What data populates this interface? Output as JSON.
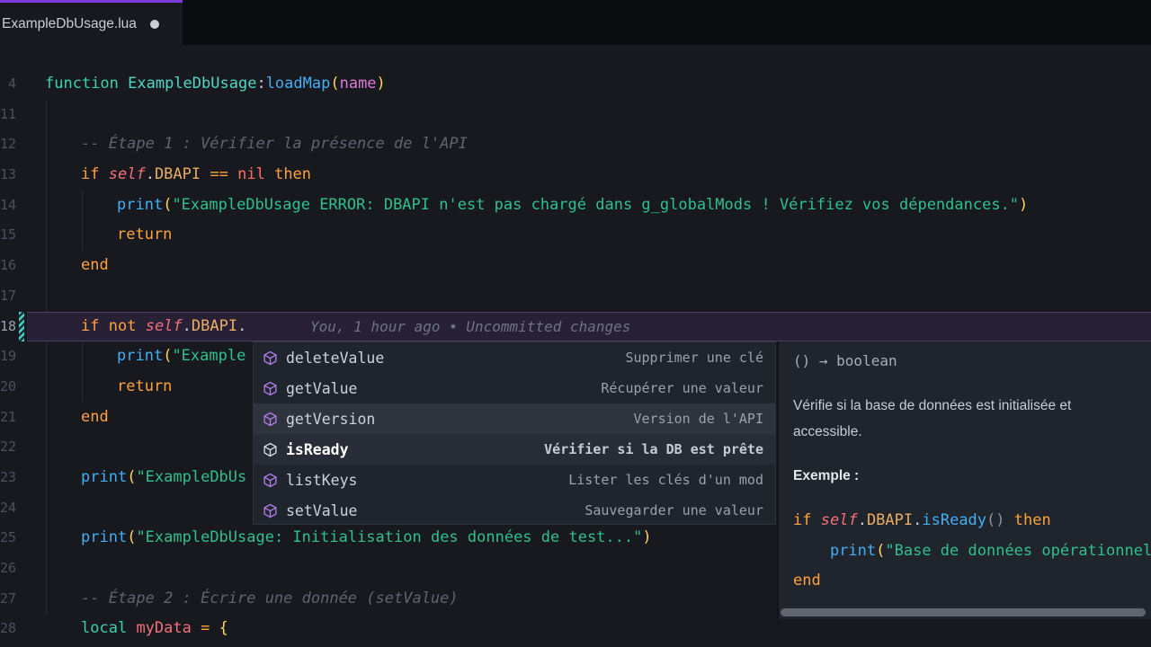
{
  "tab": {
    "title": "ExampleDbUsage.lua",
    "modified": true
  },
  "colors": {
    "editor_bg": "#17191e",
    "tabbar_bg": "#0b0c10",
    "tab_accent": "#7e3bd8",
    "popup_bg": "#20242c",
    "current_line_bg": "#282136",
    "git_modified": "#40d4c6",
    "keyword": "#ffa23e",
    "string": "#2fc08c",
    "function": "#43aef3",
    "property": "#e8ae62",
    "self": "#f2707c",
    "comment": "#5d6470",
    "method_icon": "#b07ce8"
  },
  "editor": {
    "blame": "You, 1 hour ago • Uncommitted changes",
    "lines": [
      {
        "num": "4",
        "indent": 0,
        "tokens": [
          [
            "decl",
            "function"
          ],
          [
            "plain",
            " "
          ],
          [
            "class",
            "ExampleDbUsage"
          ],
          [
            "punc",
            ":"
          ],
          [
            "fn",
            "loadMap"
          ],
          [
            "paren",
            "("
          ],
          [
            "param",
            "name"
          ],
          [
            "paren",
            ")"
          ]
        ]
      },
      {
        "num": "11",
        "indent": 0,
        "tokens": []
      },
      {
        "num": "12",
        "indent": 1,
        "tokens": [
          [
            "cmt",
            "-- Étape 1 : Vérifier la présence de l'API"
          ]
        ]
      },
      {
        "num": "13",
        "indent": 1,
        "tokens": [
          [
            "kw",
            "if"
          ],
          [
            "plain",
            " "
          ],
          [
            "self",
            "self"
          ],
          [
            "punc",
            "."
          ],
          [
            "prop",
            "DBAPI"
          ],
          [
            "plain",
            " "
          ],
          [
            "op",
            "=="
          ],
          [
            "plain",
            " "
          ],
          [
            "nil",
            "nil"
          ],
          [
            "plain",
            " "
          ],
          [
            "kw",
            "then"
          ]
        ]
      },
      {
        "num": "14",
        "indent": 2,
        "tokens": [
          [
            "fn",
            "print"
          ],
          [
            "paren",
            "("
          ],
          [
            "str",
            "\"ExampleDbUsage ERROR: DBAPI n'est pas chargé dans g_globalMods ! Vérifiez vos dépendances.\""
          ],
          [
            "paren",
            ")"
          ]
        ]
      },
      {
        "num": "15",
        "indent": 2,
        "tokens": [
          [
            "kw",
            "return"
          ]
        ]
      },
      {
        "num": "16",
        "indent": 1,
        "tokens": [
          [
            "kw",
            "end"
          ]
        ]
      },
      {
        "num": "17",
        "indent": 0,
        "tokens": []
      },
      {
        "num": "18",
        "indent": 1,
        "current": true,
        "tokens": [
          [
            "kw",
            "if"
          ],
          [
            "plain",
            " "
          ],
          [
            "kw",
            "not"
          ],
          [
            "plain",
            " "
          ],
          [
            "self",
            "self"
          ],
          [
            "punc",
            "."
          ],
          [
            "prop",
            "DBAPI"
          ],
          [
            "punc",
            "."
          ]
        ]
      },
      {
        "num": "19",
        "indent": 2,
        "tokens": [
          [
            "fn",
            "print"
          ],
          [
            "paren",
            "("
          ],
          [
            "str",
            "\"Example"
          ]
        ]
      },
      {
        "num": "20",
        "indent": 2,
        "tokens": [
          [
            "kw",
            "return"
          ]
        ]
      },
      {
        "num": "21",
        "indent": 1,
        "tokens": [
          [
            "kw",
            "end"
          ]
        ]
      },
      {
        "num": "22",
        "indent": 0,
        "tokens": []
      },
      {
        "num": "23",
        "indent": 1,
        "tokens": [
          [
            "fn",
            "print"
          ],
          [
            "paren",
            "("
          ],
          [
            "str",
            "\"ExampleDbUs"
          ]
        ]
      },
      {
        "num": "24",
        "indent": 0,
        "tokens": []
      },
      {
        "num": "25",
        "indent": 1,
        "tokens": [
          [
            "fn",
            "print"
          ],
          [
            "paren",
            "("
          ],
          [
            "str",
            "\"ExampleDbUsage: Initialisation des données de test...\""
          ],
          [
            "paren",
            ")"
          ]
        ]
      },
      {
        "num": "26",
        "indent": 0,
        "tokens": []
      },
      {
        "num": "27",
        "indent": 1,
        "tokens": [
          [
            "cmt",
            "-- Étape 2 : Écrire une donnée (setValue)"
          ]
        ]
      },
      {
        "num": "28",
        "indent": 1,
        "tokens": [
          [
            "decl",
            "local"
          ],
          [
            "plain",
            " "
          ],
          [
            "var",
            "myData"
          ],
          [
            "plain",
            " "
          ],
          [
            "op",
            "="
          ],
          [
            "plain",
            " "
          ],
          [
            "paren",
            "{"
          ]
        ]
      }
    ]
  },
  "suggest": {
    "items": [
      {
        "label": "deleteValue",
        "detail": "Supprimer une clé",
        "state": ""
      },
      {
        "label": "getValue",
        "detail": "Récupérer une valeur",
        "state": ""
      },
      {
        "label": "getVersion",
        "detail": "Version de l'API",
        "state": "hover"
      },
      {
        "label": "isReady",
        "detail": "Vérifier si la DB est prête",
        "state": "selected"
      },
      {
        "label": "listKeys",
        "detail": "Lister les clés d'un mod",
        "state": ""
      },
      {
        "label": "setValue",
        "detail": "Sauvegarder une valeur",
        "state": ""
      }
    ]
  },
  "docs": {
    "signature": "() → boolean",
    "description": "Vérifie si la base de données est initialisée et accessible.",
    "example_label": "Exemple :",
    "code": [
      [
        [
          "kw",
          "if"
        ],
        [
          "plain",
          " "
        ],
        [
          "self",
          "self"
        ],
        [
          "punc",
          "."
        ],
        [
          "prop",
          "DBAPI"
        ],
        [
          "punc",
          "."
        ],
        [
          "fn",
          "isReady"
        ],
        [
          "punc2",
          "()"
        ],
        [
          "plain",
          " "
        ],
        [
          "kw",
          "then"
        ]
      ],
      [
        [
          "plain",
          "    "
        ],
        [
          "fn",
          "print"
        ],
        [
          "paren",
          "("
        ],
        [
          "str",
          "\"Base de données opérationnell"
        ]
      ],
      [
        [
          "kw",
          "end"
        ]
      ]
    ]
  }
}
